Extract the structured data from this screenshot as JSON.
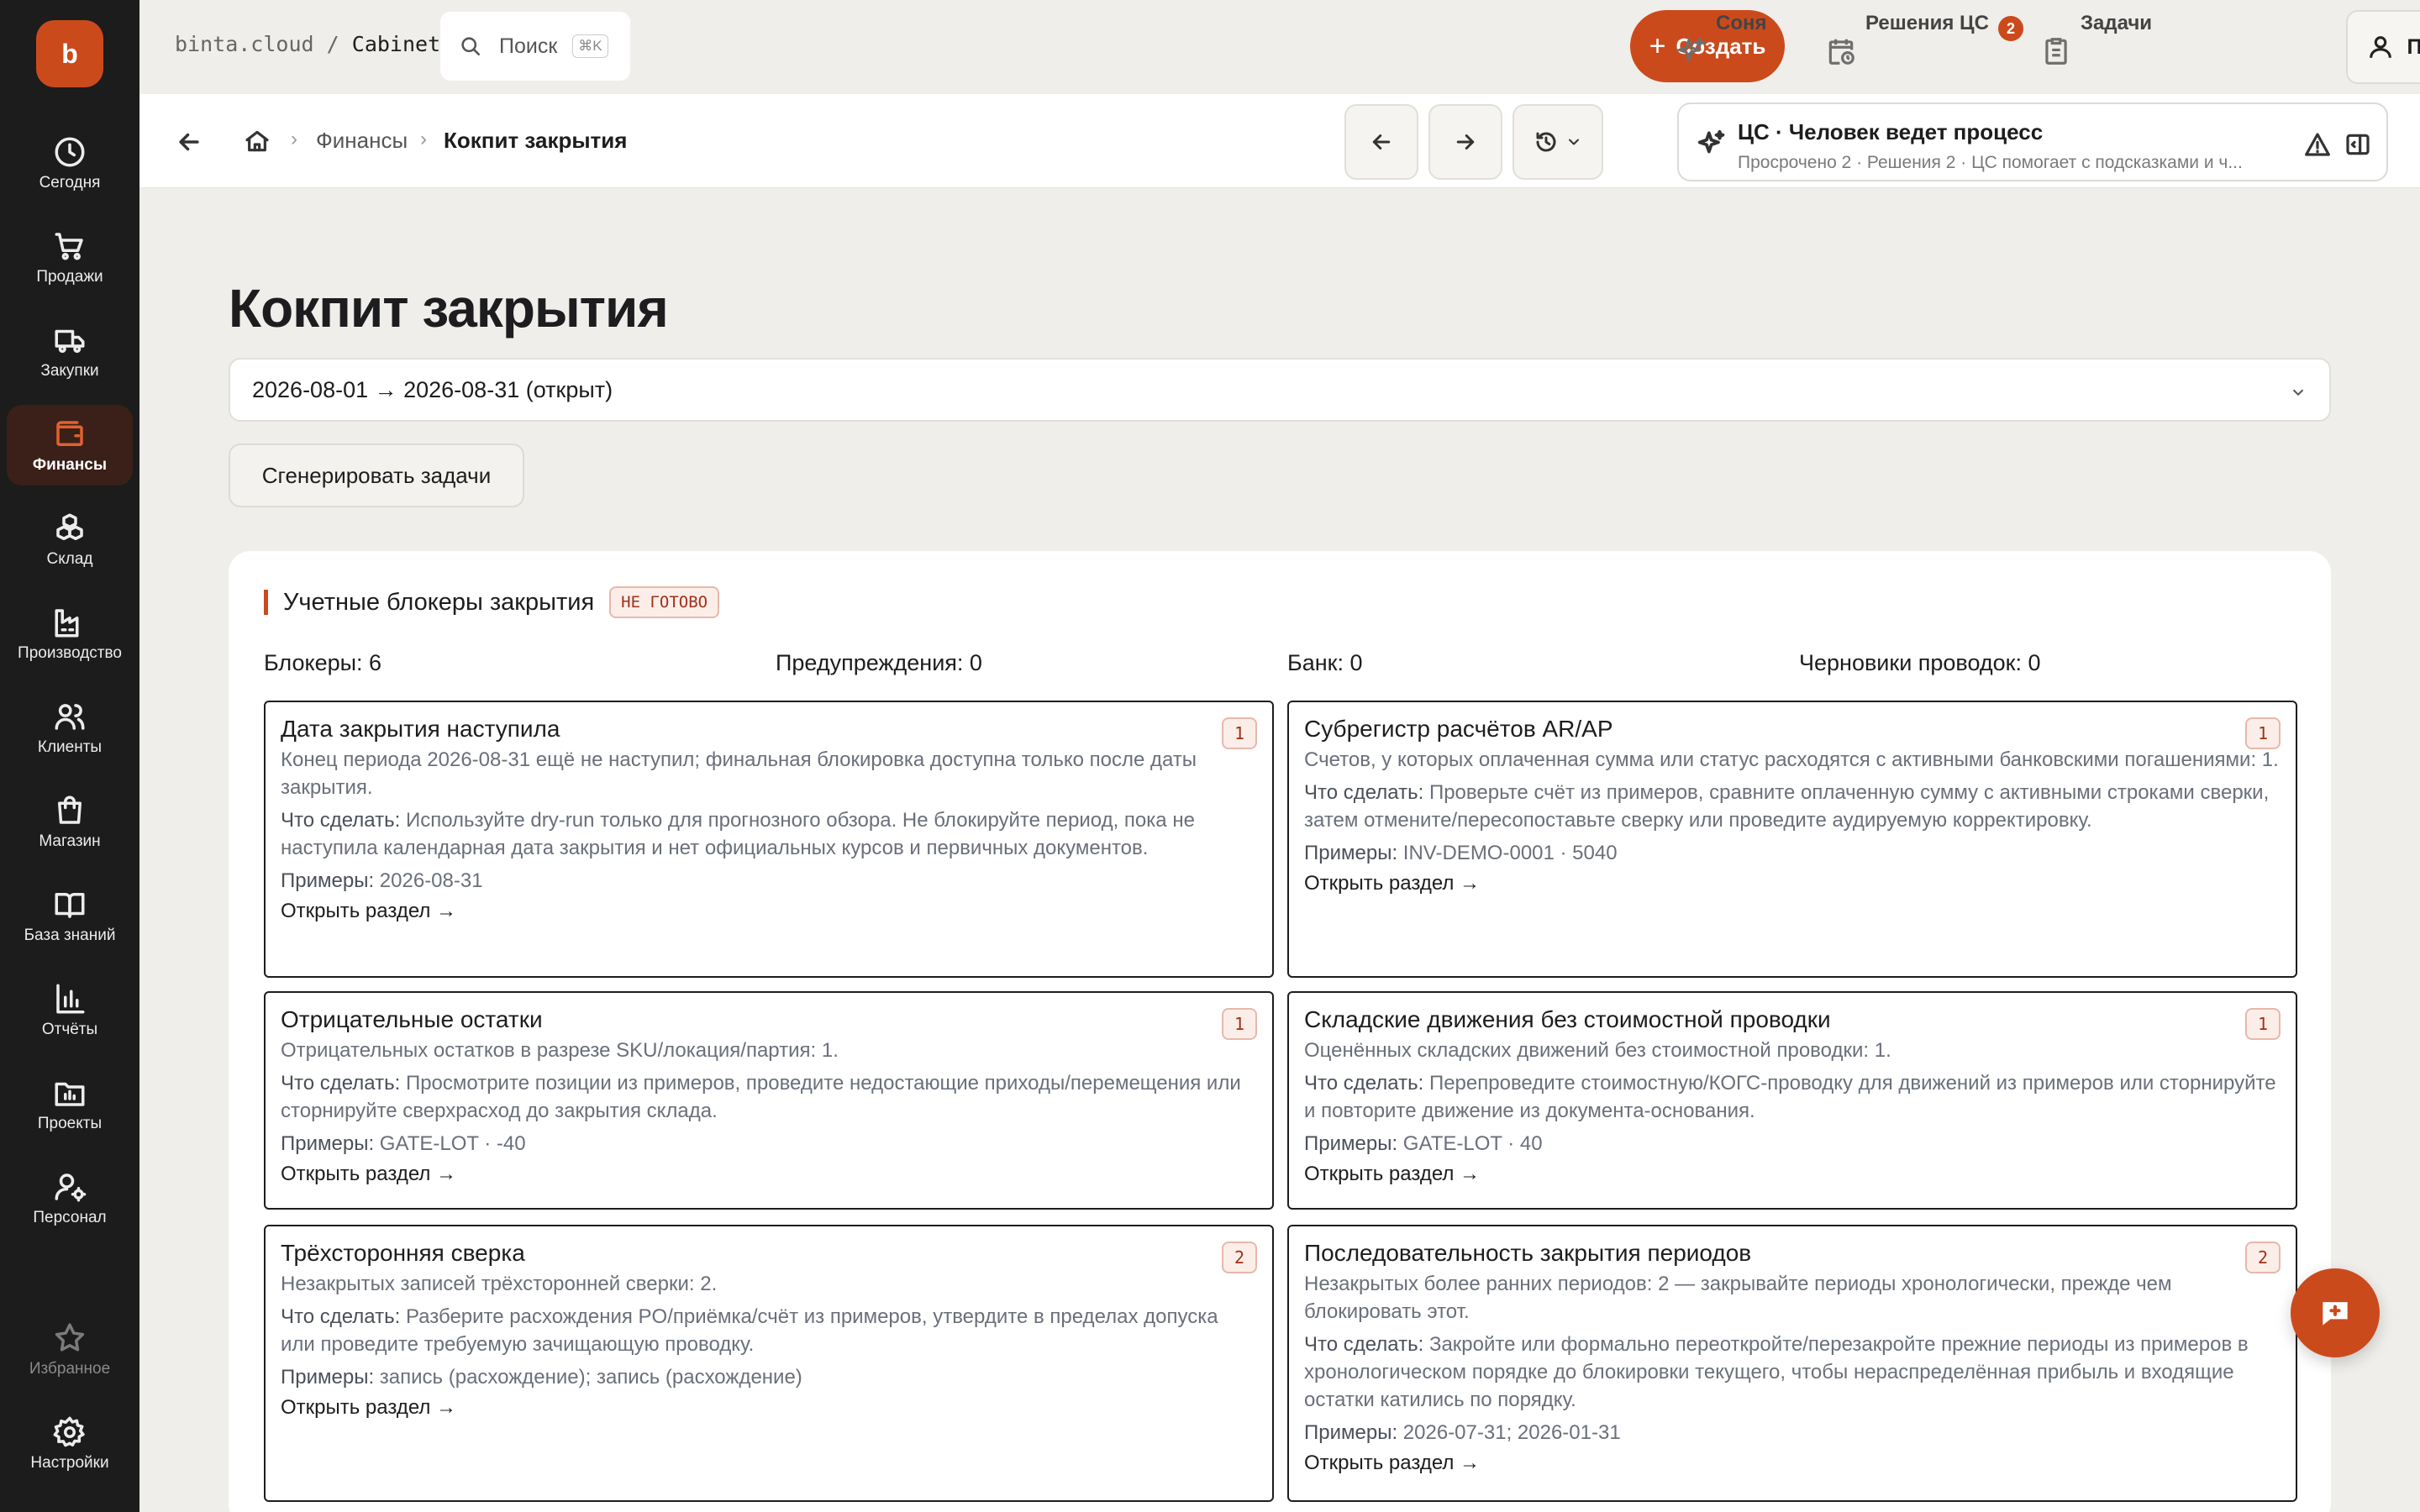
{
  "app": {
    "logo_letter": "b",
    "path_host": "binta.cloud",
    "path_sep": "/",
    "path_section": "Cabinet"
  },
  "sidebar": {
    "items": [
      {
        "label": "Сегодня",
        "icon": "clock-icon"
      },
      {
        "label": "Продажи",
        "icon": "cart-icon"
      },
      {
        "label": "Закупки",
        "icon": "truck-icon"
      },
      {
        "label": "Финансы",
        "icon": "wallet-icon",
        "active": true
      },
      {
        "label": "Склад",
        "icon": "boxes-icon"
      },
      {
        "label": "Производство",
        "icon": "factory-icon"
      },
      {
        "label": "Клиенты",
        "icon": "users-icon"
      },
      {
        "label": "Магазин",
        "icon": "bag-icon"
      },
      {
        "label": "База знаний",
        "icon": "book-icon"
      },
      {
        "label": "Отчёты",
        "icon": "bar-chart-icon"
      },
      {
        "label": "Проекты",
        "icon": "folder-chart-icon"
      },
      {
        "label": "Персонал",
        "icon": "user-gear-icon"
      },
      {
        "label": "Избранное",
        "icon": "star-icon"
      },
      {
        "label": "Настройки",
        "icon": "gear-icon"
      }
    ]
  },
  "topbar": {
    "search_placeholder": "Поиск",
    "search_shortcut": "⌘K",
    "create_label": "Создать",
    "sonya_label": "Соня",
    "decisions_label": "Решения ЦС",
    "decisions_badge": "2",
    "tasks_label": "Задачи",
    "profile_label": "Профиль"
  },
  "breadcrumb": {
    "finance": "Финансы",
    "current": "Кокпит закрытия",
    "sep": "›"
  },
  "cs_panel": {
    "title": "ЦС · Человек ведет процесс",
    "subtitle": "Просрочено 2 · Решения 2 · ЦС помогает с подсказками и ч..."
  },
  "page": {
    "title": "Кокпит закрытия",
    "period": "2026-08-01 → 2026-08-31 (открыт)",
    "generate_label": "Сгенерировать задачи"
  },
  "section": {
    "title": "Учетные блокеры закрытия",
    "status": "НЕ ГОТОВО",
    "stats": {
      "blockers": "Блокеры: 6",
      "warnings": "Предупреждения: 0",
      "bank": "Банк: 0",
      "drafts": "Черновики проводок: 0"
    },
    "do_prefix": "Что сделать:",
    "ex_prefix": "Примеры:",
    "open_link": "Открыть раздел →",
    "items": [
      {
        "title": "Дата закрытия наступила",
        "count": "1",
        "desc": "Конец периода 2026-08-31 ещё не наступил; финальная блокировка доступна только после даты закрытия.",
        "todo": "Используйте dry-run только для прогнозного обзора. Не блокируйте период, пока не наступила календарная дата закрытия и нет официальных курсов и первичных документов.",
        "examples": "2026-08-31"
      },
      {
        "title": "Субрегистр расчётов AR/AP",
        "count": "1",
        "desc": "Счетов, у которых оплаченная сумма или статус расходятся с активными банковскими погашениями: 1.",
        "todo": "Проверьте счёт из примеров, сравните оплаченную сумму с активными строками сверки, затем отмените/пересопоставьте сверку или проведите аудируемую корректировку.",
        "examples": "INV-DEMO-0001 · 5040"
      },
      {
        "title": "Отрицательные остатки",
        "count": "1",
        "desc": "Отрицательных остатков в разрезе SKU/локация/партия: 1.",
        "todo": "Просмотрите позиции из примеров, проведите недостающие приходы/перемещения или сторнируйте сверхрасход до закрытия склада.",
        "examples": "GATE-LOT · -40"
      },
      {
        "title": "Складские движения без стоимостной проводки",
        "count": "1",
        "desc": "Оценённых складских движений без стоимостной проводки: 1.",
        "todo": "Перепроведите стоимостную/КОГС-проводку для движений из примеров или сторнируйте и повторите движение из документа-основания.",
        "examples": "GATE-LOT · 40"
      },
      {
        "title": "Трёхсторонняя сверка",
        "count": "2",
        "desc": "Незакрытых записей трёхсторонней сверки: 2.",
        "todo": "Разберите расхождения PO/приёмка/счёт из примеров, утвердите в пределах допуска или проведите требуемую зачищающую проводку.",
        "examples": "запись (расхождение); запись (расхождение)"
      },
      {
        "title": "Последовательность закрытия периодов",
        "count": "2",
        "desc": "Незакрытых более ранних периодов: 2 — закрывайте периоды хронологически, прежде чем блокировать этот.",
        "todo": "Закройте или формально переоткройте/перезакройте прежние периоды из примеров в хронологическом порядке до блокировки текущего, чтобы нераспределённая прибыль и входящие остатки катились по порядку.",
        "examples": "2026-07-31; 2026-01-31"
      }
    ]
  },
  "colors": {
    "accent": "#CB4A1C",
    "sidebar_bg": "#1c1c1c",
    "page_bg": "#EFEEEA"
  }
}
